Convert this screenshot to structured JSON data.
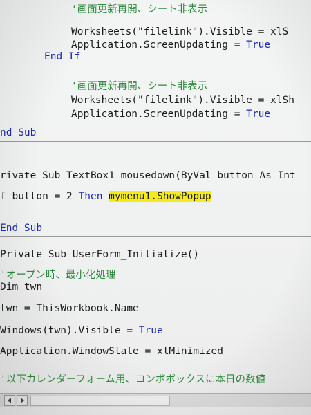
{
  "code": {
    "line_01": "'画面更新再開、シート非表示",
    "line_02": "Worksheets(\"filelink\").Visible = xlS",
    "line_03": "Application.ScreenUpdating = ",
    "line_03_kw": "True",
    "line_04": "End If",
    "line_05": "'画面更新再開、シート非表示",
    "line_06": "Worksheets(\"filelink\").Visible = xlSh",
    "line_07": "Application.ScreenUpdating = ",
    "line_07_kw": "True",
    "line_08": "nd Sub",
    "line_09": "rivate Sub TextBox1_mousedown(ByVal button As Int",
    "line_10_a": "f button = 2 ",
    "line_10_kw": "Then",
    "line_10_hl": "mymenu1.ShowPopup",
    "line_11": "End Sub",
    "line_12": "Private Sub UserForm_Initialize()",
    "line_13": "'オープン時、最小化処理",
    "line_14": "Dim twn",
    "line_15": "twn = ThisWorkbook.Name",
    "line_16": "Windows(twn).Visible = ",
    "line_16_kw": "True",
    "line_17": "Application.WindowState = xlMinimized",
    "line_18": "'以下カレンダーフォーム用、コンボボックスに本日の数値"
  },
  "colors": {
    "keyword": "#1d2bb2",
    "comment": "#2e8b3f",
    "highlight": "#f5ea1c",
    "text": "#1c1c1c",
    "background": "#f2f3f3"
  }
}
